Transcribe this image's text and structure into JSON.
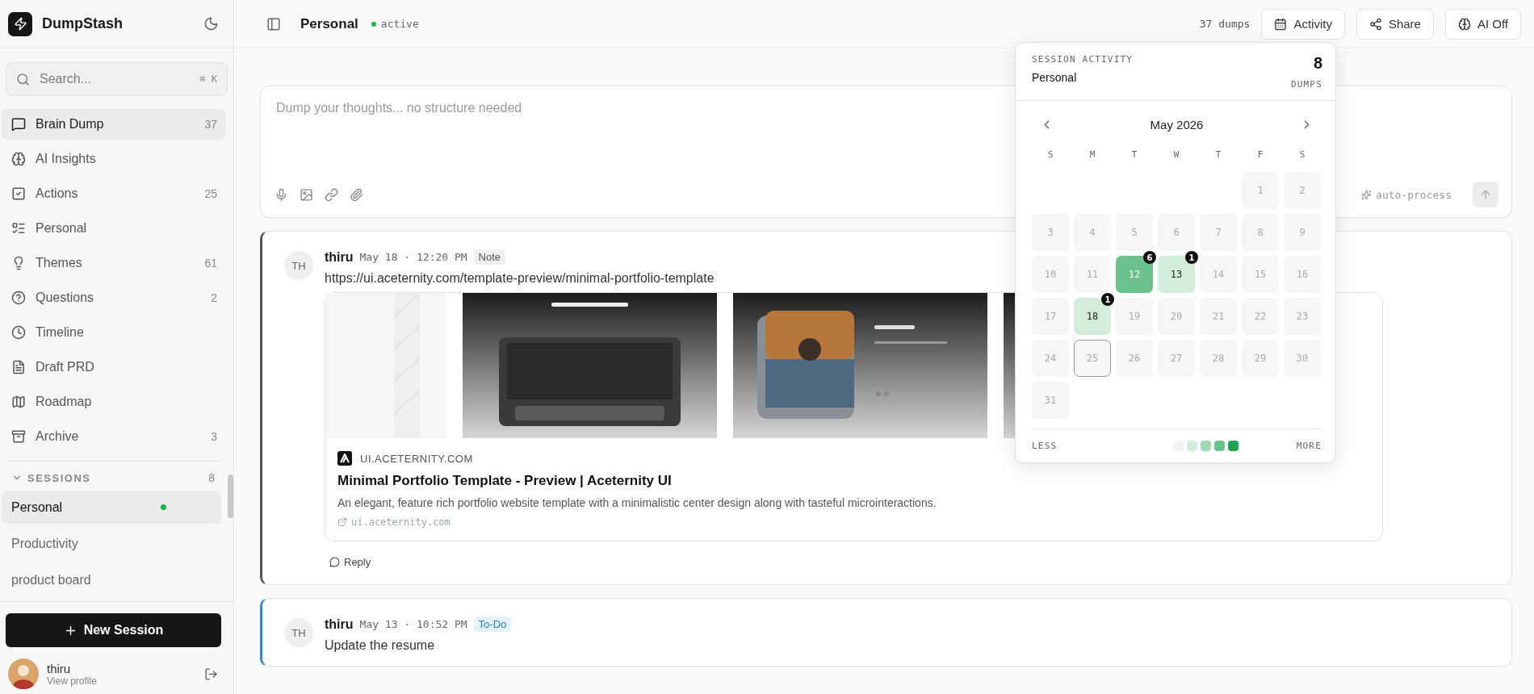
{
  "app": {
    "name": "DumpStash"
  },
  "search": {
    "placeholder": "Search...",
    "shortcut": "⌘ K"
  },
  "nav": [
    {
      "label": "Brain Dump",
      "count": "37",
      "selected": true
    },
    {
      "label": "AI Insights",
      "selected": false
    },
    {
      "label": "Actions",
      "count": "25",
      "selected": false
    },
    {
      "label": "Personal",
      "selected": false
    },
    {
      "label": "Themes",
      "count": "61",
      "selected": false
    },
    {
      "label": "Questions",
      "count": "2",
      "selected": false
    },
    {
      "label": "Timeline",
      "selected": false
    },
    {
      "label": "Draft PRD",
      "selected": false
    },
    {
      "label": "Roadmap",
      "selected": false
    },
    {
      "label": "Archive",
      "count": "3",
      "selected": false
    }
  ],
  "sessions": {
    "label": "SESSIONS",
    "count": "8",
    "expanded": true,
    "items": [
      {
        "label": "Personal",
        "selected": true,
        "active": true
      },
      {
        "label": "Productivity",
        "selected": false,
        "active": false
      },
      {
        "label": "product board",
        "selected": false,
        "active": false
      }
    ]
  },
  "new_session": "New Session",
  "user": {
    "name": "thiru",
    "link": "View profile"
  },
  "header": {
    "title": "Personal",
    "status": "active",
    "count": "37 dumps",
    "buttons": [
      "Activity",
      "Share",
      "AI Off"
    ]
  },
  "composer": {
    "placeholder": "Dump your thoughts... no structure needed",
    "auto_process": "auto-process"
  },
  "posts": [
    {
      "kind": "note",
      "initials": "TH",
      "author": "thiru",
      "date": "May 18 · 12:20 PM",
      "tag": "Note",
      "text": "https://ui.aceternity.com/template-preview/minimal-portfolio-template",
      "link_preview": {
        "domain": "UI.ACETERNITY.COM",
        "title": "Minimal Portfolio Template - Preview | Aceternity UI",
        "description": "An elegant, feature rich portfolio website template with a minimalistic center design along with tasteful microinteractions.",
        "url": "ui.aceternity.com"
      },
      "reply": "Reply"
    },
    {
      "kind": "todo",
      "initials": "TH",
      "author": "thiru",
      "date": "May 13 · 10:52 PM",
      "tag": "To-Do",
      "text": "Update the resume"
    }
  ],
  "activity": {
    "label": "SESSION ACTIVITY",
    "session": "Personal",
    "total": "8",
    "total_label": "DUMPS",
    "month": "May 2026",
    "weekdays": [
      "S",
      "M",
      "T",
      "W",
      "T",
      "F",
      "S"
    ],
    "weeks": [
      {
        "kind": "first",
        "days": [
          {
            "day": "1"
          },
          {
            "day": "2"
          }
        ]
      },
      {
        "kind": "full",
        "days": [
          {
            "day": "3"
          },
          {
            "day": "4"
          },
          {
            "day": "5"
          },
          {
            "day": "6"
          },
          {
            "day": "7"
          },
          {
            "day": "8"
          },
          {
            "day": "9"
          }
        ]
      },
      {
        "kind": "full",
        "days": [
          {
            "day": "10"
          },
          {
            "day": "11"
          },
          {
            "day": "12",
            "count": "6",
            "color": "#6cc28c"
          },
          {
            "day": "13",
            "count": "1",
            "color": "#d2eedb"
          },
          {
            "day": "14"
          },
          {
            "day": "15"
          },
          {
            "day": "16"
          }
        ]
      },
      {
        "kind": "full",
        "days": [
          {
            "day": "17"
          },
          {
            "day": "18",
            "count": "1",
            "color": "#d2eedb"
          },
          {
            "day": "19"
          },
          {
            "day": "20"
          },
          {
            "day": "21"
          },
          {
            "day": "22"
          },
          {
            "day": "23"
          }
        ]
      },
      {
        "kind": "full",
        "days": [
          {
            "day": "24"
          },
          {
            "day": "25",
            "today": true
          },
          {
            "day": "26"
          },
          {
            "day": "27"
          },
          {
            "day": "28"
          },
          {
            "day": "29"
          },
          {
            "day": "30"
          }
        ]
      },
      {
        "kind": "last",
        "days": [
          {
            "day": "31"
          }
        ]
      }
    ],
    "legend": {
      "less": "LESS",
      "more": "MORE",
      "swatches": [
        {
          "color": "#f4f4f4"
        },
        {
          "color": "#d2eedb"
        },
        {
          "color": "#a3dab6"
        },
        {
          "color": "#6cc28c"
        },
        {
          "color": "#1fa350"
        }
      ]
    }
  }
}
